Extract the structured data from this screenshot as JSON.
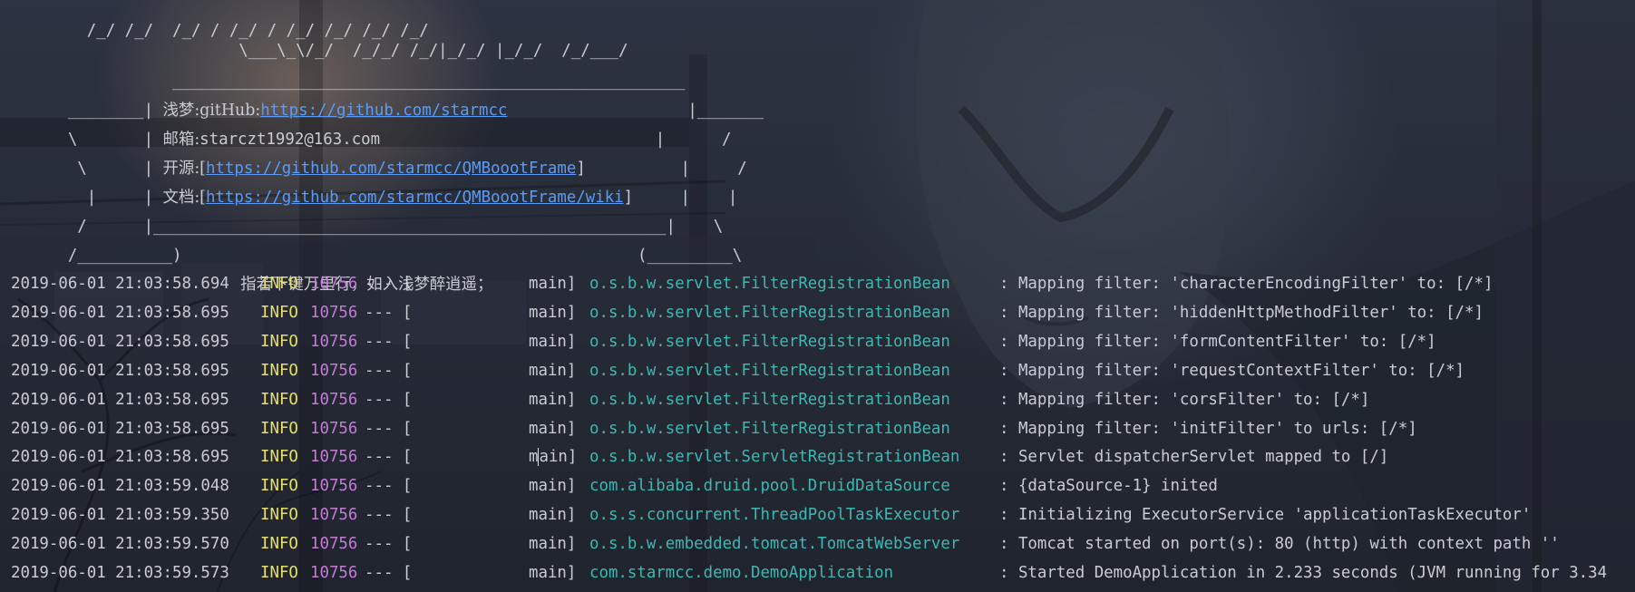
{
  "banner": {
    "art_line_1": "  /_/ /_/  /_/ / /_/ / /_/ /_/ /_/ /_/",
    "art_line_2": "                  \\___\\_\\/_/  /_/_/ /_/|_/_/ |_/_/  /_/___/",
    "rule_top": "           ______________________________________________________",
    "box_1_left": "________| ",
    "box_1_label": "浅梦:gitHub:",
    "box_1_link": "https://github.com/starmcc",
    "box_1_right": "                   |_______",
    "box_2_left": "\\       | ",
    "box_2_label": "邮箱:",
    "box_2_value": "starczt1992@163.com",
    "box_2_right": "                             |      /",
    "box_3_left": " \\      | ",
    "box_3_label": "开源:[",
    "box_3_link": "https://github.com/starmcc/QMBoootFrame",
    "box_3_right": "]          |     /",
    "box_4_left": "  |     | ",
    "box_4_label": "文档:[",
    "box_4_link": "https://github.com/starmcc/QMBoootFrame/wiki",
    "box_4_right": "]     |    |",
    "box_5": " /      |______________________________________________________|    \\",
    "box_6": "/__________)                                                (_________\\",
    "motto": "指若下键万里行，如入浅梦醉逍遥；"
  },
  "log_entries": [
    {
      "timestamp": "2019-06-01 21:03:58.694",
      "level": "INFO",
      "pid": "10756",
      "sep": "--- [",
      "thread": "main]",
      "logger": "o.s.b.w.servlet.FilterRegistrationBean",
      "message": ": Mapping filter: 'characterEncodingFilter' to: [/*]"
    },
    {
      "timestamp": "2019-06-01 21:03:58.695",
      "level": "INFO",
      "pid": "10756",
      "sep": "--- [",
      "thread": "main]",
      "logger": "o.s.b.w.servlet.FilterRegistrationBean",
      "message": ": Mapping filter: 'hiddenHttpMethodFilter' to: [/*]"
    },
    {
      "timestamp": "2019-06-01 21:03:58.695",
      "level": "INFO",
      "pid": "10756",
      "sep": "--- [",
      "thread": "main]",
      "logger": "o.s.b.w.servlet.FilterRegistrationBean",
      "message": ": Mapping filter: 'formContentFilter' to: [/*]"
    },
    {
      "timestamp": "2019-06-01 21:03:58.695",
      "level": "INFO",
      "pid": "10756",
      "sep": "--- [",
      "thread": "main]",
      "logger": "o.s.b.w.servlet.FilterRegistrationBean",
      "message": ": Mapping filter: 'requestContextFilter' to: [/*]"
    },
    {
      "timestamp": "2019-06-01 21:03:58.695",
      "level": "INFO",
      "pid": "10756",
      "sep": "--- [",
      "thread": "main]",
      "logger": "o.s.b.w.servlet.FilterRegistrationBean",
      "message": ": Mapping filter: 'corsFilter' to: [/*]"
    },
    {
      "timestamp": "2019-06-01 21:03:58.695",
      "level": "INFO",
      "pid": "10756",
      "sep": "--- [",
      "thread": "main]",
      "logger": "o.s.b.w.servlet.FilterRegistrationBean",
      "message": ": Mapping filter: 'initFilter' to urls: [/*]"
    },
    {
      "timestamp": "2019-06-01 21:03:58.695",
      "level": "INFO",
      "pid": "10756",
      "sep": "--- [",
      "thread": "main]",
      "logger": "o.s.b.w.servlet.ServletRegistrationBean",
      "message": ": Servlet dispatcherServlet mapped to [/]"
    },
    {
      "timestamp": "2019-06-01 21:03:59.048",
      "level": "INFO",
      "pid": "10756",
      "sep": "--- [",
      "thread": "main]",
      "logger": "com.alibaba.druid.pool.DruidDataSource",
      "message": ": {dataSource-1} inited"
    },
    {
      "timestamp": "2019-06-01 21:03:59.350",
      "level": "INFO",
      "pid": "10756",
      "sep": "--- [",
      "thread": "main]",
      "logger": "o.s.s.concurrent.ThreadPoolTaskExecutor",
      "message": ": Initializing ExecutorService 'applicationTaskExecutor'"
    },
    {
      "timestamp": "2019-06-01 21:03:59.570",
      "level": "INFO",
      "pid": "10756",
      "sep": "--- [",
      "thread": "main]",
      "logger": "o.s.b.w.embedded.tomcat.TomcatWebServer",
      "message": ": Tomcat started on port(s): 80 (http) with context path ''"
    },
    {
      "timestamp": "2019-06-01 21:03:59.573",
      "level": "INFO",
      "pid": "10756",
      "sep": "--- [",
      "thread": "main]",
      "logger": "com.starmcc.demo.DemoApplication",
      "message": ": Started DemoApplication in 2.233 seconds (JVM running for 3.34"
    }
  ],
  "colors": {
    "info_level": "#e6e06a",
    "pid": "#c57ad8",
    "logger": "#3fb7b1",
    "link": "#5b9bf5",
    "text": "#c9ccd3"
  }
}
